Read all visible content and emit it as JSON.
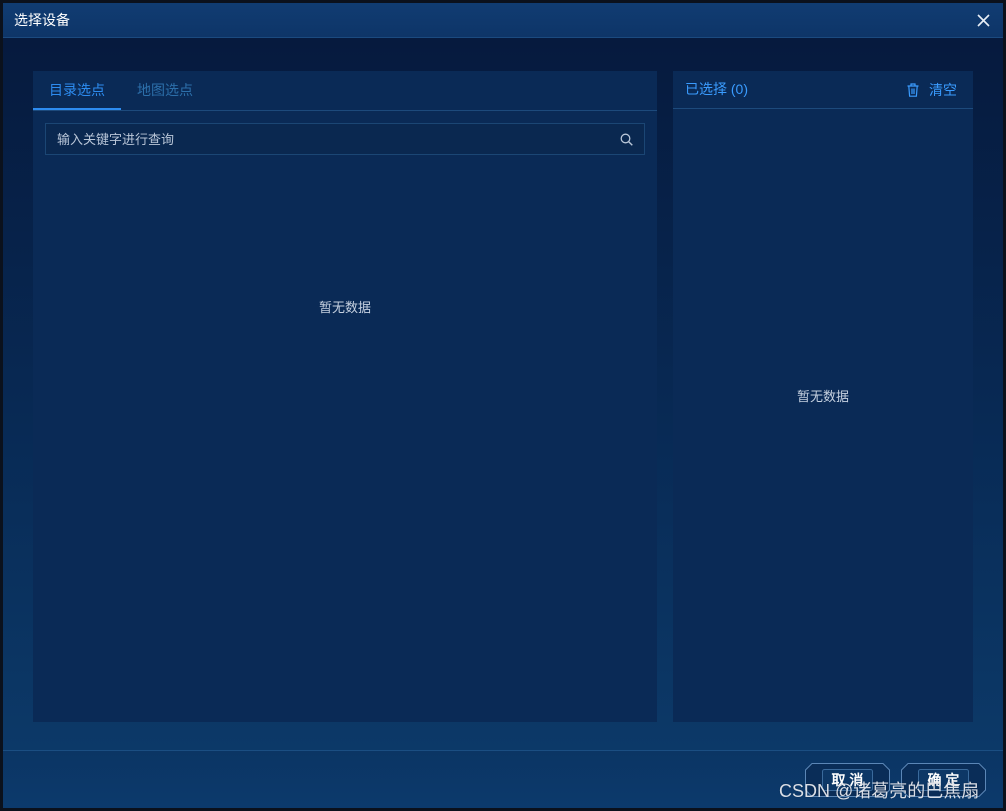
{
  "dialog": {
    "title": "选择设备",
    "close_icon": "close-icon"
  },
  "left_panel": {
    "tabs": [
      {
        "label": "目录选点",
        "active": true
      },
      {
        "label": "地图选点",
        "active": false
      }
    ],
    "search": {
      "placeholder": "输入关键字进行查询",
      "value": "",
      "icon": "search-icon"
    },
    "empty_text": "暂无数据"
  },
  "right_panel": {
    "header_label": "已选择 (0)",
    "clear_label": "清空",
    "clear_icon": "trash-icon",
    "empty_text": "暂无数据"
  },
  "footer": {
    "cancel_label": "取 消",
    "confirm_label": "确 定"
  },
  "watermark": "CSDN @诸葛亮的巴焦扇",
  "colors": {
    "accent": "#2d8cf0",
    "title_bar": "#103c72",
    "panel_bg": "#0a2a56",
    "dialog_bg_top": "#061a3e",
    "dialog_bg_bottom": "#0c3968"
  }
}
